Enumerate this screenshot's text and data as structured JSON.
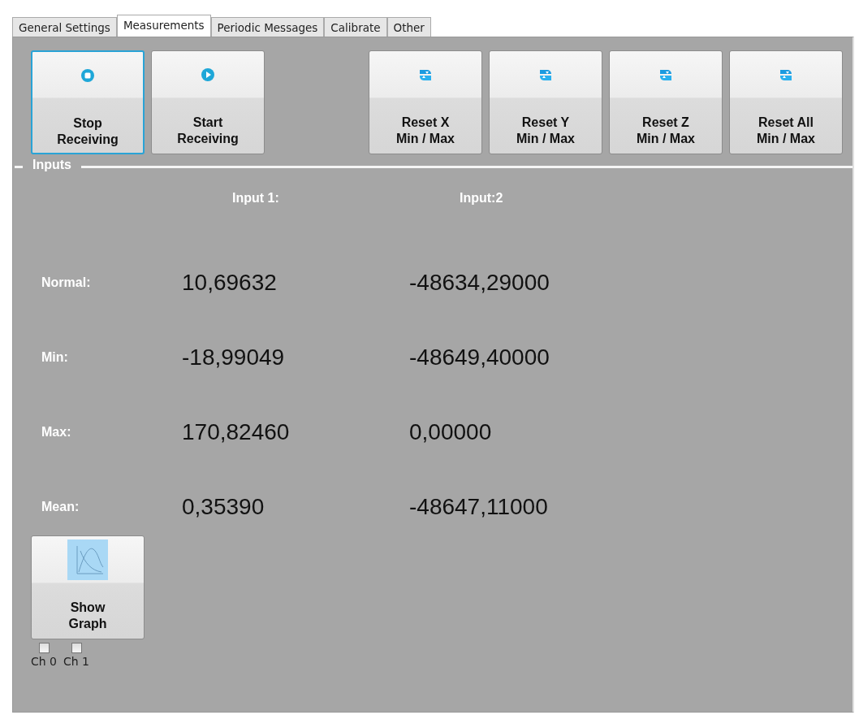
{
  "tabs": [
    {
      "label": "General Settings",
      "selected": false
    },
    {
      "label": "Measurements",
      "selected": true
    },
    {
      "label": "Periodic Messages",
      "selected": false
    },
    {
      "label": "Calibrate",
      "selected": false
    },
    {
      "label": "Other",
      "selected": false
    }
  ],
  "toolbar": {
    "left": [
      {
        "label": "Stop\nReceiving",
        "kind": "stop",
        "focused": true
      },
      {
        "label": "Start\nReceiving",
        "kind": "play",
        "focused": false
      }
    ],
    "right": [
      {
        "label": "Reset X\nMin / Max",
        "kind": "reset",
        "focused": false
      },
      {
        "label": "Reset Y\nMin / Max",
        "kind": "reset",
        "focused": false
      },
      {
        "label": "Reset Z\nMin / Max",
        "kind": "reset",
        "focused": false
      },
      {
        "label": "Reset All\nMin / Max",
        "kind": "reset",
        "focused": false
      }
    ]
  },
  "inputs": {
    "title": "Inputs",
    "columns": [
      "Input 1:",
      "Input:2"
    ],
    "rows": [
      {
        "label": "Normal:",
        "values": [
          "10,69632",
          "-48634,29000"
        ]
      },
      {
        "label": "Min:",
        "values": [
          "-18,99049",
          "-48649,40000"
        ]
      },
      {
        "label": "Max:",
        "values": [
          "170,82460",
          "0,00000"
        ]
      },
      {
        "label": "Mean:",
        "values": [
          "0,35390",
          "-48647,11000"
        ]
      }
    ]
  },
  "graph_button": {
    "label": "Show\nGraph",
    "kind": "graph",
    "focused": false
  },
  "channels": [
    {
      "label": "Ch 0",
      "checked": false
    },
    {
      "label": "Ch 1",
      "checked": false
    }
  ]
}
